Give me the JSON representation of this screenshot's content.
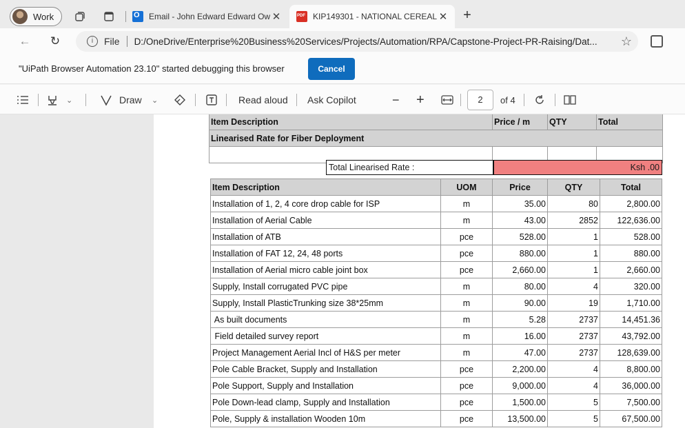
{
  "tabs": {
    "profile_label": "Work",
    "items": [
      {
        "title": "Email - John Edward Edward Ow",
        "active": false
      },
      {
        "title": "KIP149301 - NATIONAL CEREALS",
        "active": true
      }
    ]
  },
  "address": {
    "scheme": "File",
    "url": "D:/OneDrive/Enterprise%20Business%20Services/Projects/Automation/RPA/Capstone-Project-PR-Raising/Dat..."
  },
  "debug": {
    "message": "\"UiPath Browser Automation 23.10\" started debugging this browser",
    "cancel_label": "Cancel"
  },
  "pdf_toolbar": {
    "draw_label": "Draw",
    "read_aloud_label": "Read aloud",
    "ask_copilot_label": "Ask Copilot",
    "page_current": "2",
    "page_total": "of 4"
  },
  "document": {
    "top_header": {
      "desc": "Item Description",
      "price": "Price / m",
      "qty": "QTY",
      "total": "Total"
    },
    "section_title": "Linearised Rate for Fiber Deployment",
    "rate_label": "Total Linearised Rate :",
    "rate_value": "Ksh .00",
    "headers": {
      "desc": "Item Description",
      "uom": "UOM",
      "price": "Price",
      "qty": "QTY",
      "total": "Total"
    },
    "rows": [
      {
        "desc": "Installation of 1, 2, 4 core drop cable for ISP",
        "uom": "m",
        "price": "35.00",
        "qty": "80",
        "total": "2,800.00"
      },
      {
        "desc": "Installation of Aerial Cable",
        "uom": "m",
        "price": "43.00",
        "qty": "2852",
        "total": "122,636.00"
      },
      {
        "desc": "Installation of ATB",
        "uom": "pce",
        "price": "528.00",
        "qty": "1",
        "total": "528.00"
      },
      {
        "desc": "Installation of FAT 12, 24, 48 ports",
        "uom": "pce",
        "price": "880.00",
        "qty": "1",
        "total": "880.00"
      },
      {
        "desc": "Installation of Aerial micro cable joint box",
        "uom": "pce",
        "price": "2,660.00",
        "qty": "1",
        "total": "2,660.00"
      },
      {
        "desc": "Supply, Install corrugated PVC pipe",
        "uom": "m",
        "price": "80.00",
        "qty": "4",
        "total": "320.00"
      },
      {
        "desc": "Supply, Install PlasticTrunking size 38*25mm",
        "uom": "m",
        "price": "90.00",
        "qty": "19",
        "total": "1,710.00"
      },
      {
        "desc": " As built documents",
        "uom": "m",
        "price": "5.28",
        "qty": "2737",
        "total": "14,451.36"
      },
      {
        "desc": " Field detailed survey report",
        "uom": "m",
        "price": "16.00",
        "qty": "2737",
        "total": "43,792.00"
      },
      {
        "desc": "Project Management Aerial Incl of H&S per meter",
        "uom": "m",
        "price": "47.00",
        "qty": "2737",
        "total": "128,639.00"
      },
      {
        "desc": "Pole Cable Bracket, Supply and Installation",
        "uom": "pce",
        "price": "2,200.00",
        "qty": "4",
        "total": "8,800.00"
      },
      {
        "desc": "Pole Support, Supply and Installation",
        "uom": "pce",
        "price": "9,000.00",
        "qty": "4",
        "total": "36,000.00"
      },
      {
        "desc": "Pole Down-lead clamp, Supply and Installation",
        "uom": "pce",
        "price": "1,500.00",
        "qty": "5",
        "total": "7,500.00"
      },
      {
        "desc": "Pole, Supply & installation Wooden 10m",
        "uom": "pce",
        "price": "13,500.00",
        "qty": "5",
        "total": "67,500.00"
      }
    ]
  }
}
